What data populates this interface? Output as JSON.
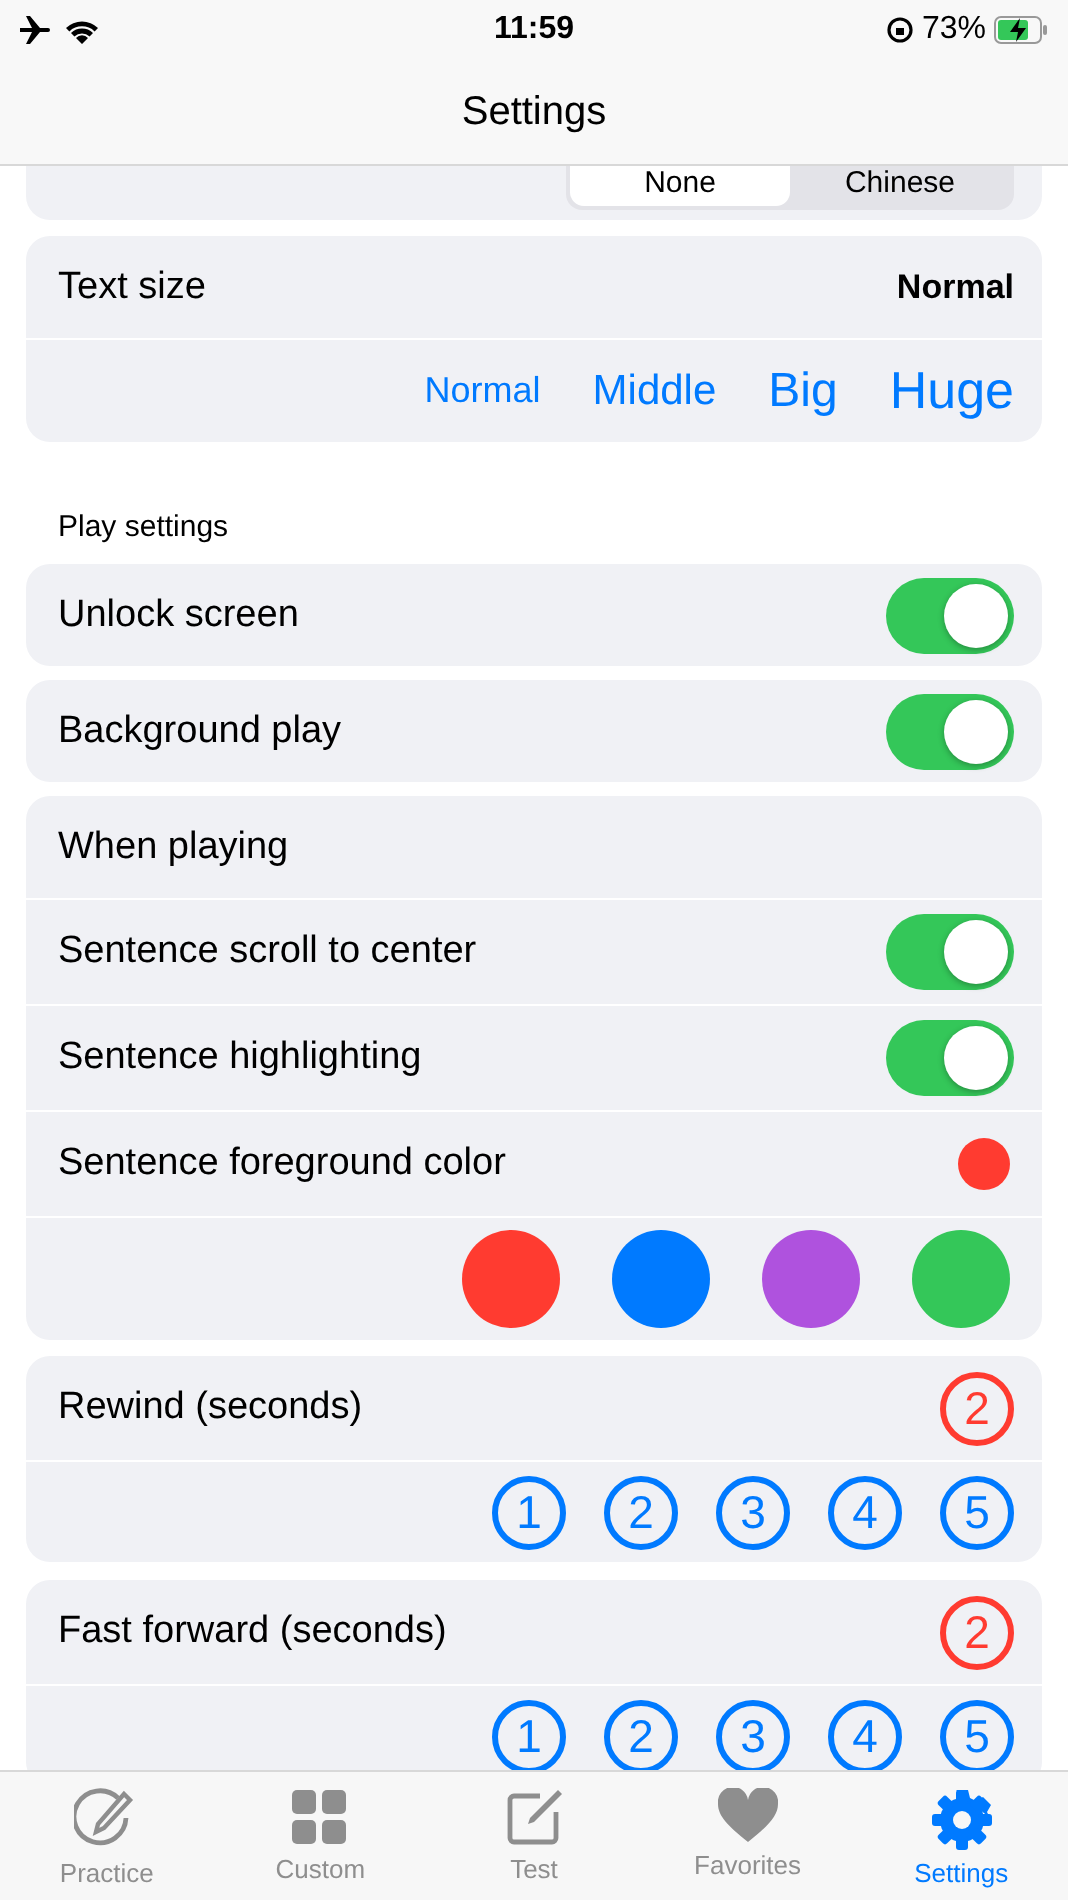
{
  "status_bar": {
    "time": "11:59",
    "battery": "73%"
  },
  "nav": {
    "title": "Settings"
  },
  "language_segments": [
    {
      "label": "None",
      "selected": true
    },
    {
      "label": "Chinese",
      "selected": false
    }
  ],
  "text_size": {
    "label": "Text size",
    "value": "Normal",
    "options": [
      "Normal",
      "Middle",
      "Big",
      "Huge"
    ]
  },
  "section_header": "Play settings",
  "toggles": [
    {
      "label": "Unlock screen",
      "on": true
    },
    {
      "label": "Background play",
      "on": true
    }
  ],
  "when_playing": {
    "label": "When playing",
    "toggles": [
      {
        "label": "Sentence scroll to center",
        "on": true
      },
      {
        "label": "Sentence highlighting",
        "on": true
      }
    ],
    "color_setting": {
      "label": "Sentence foreground color",
      "color": "#ff3b30",
      "options": [
        {
          "color": "#ff3b30"
        },
        {
          "color": "#007aff"
        },
        {
          "color": "#af52de"
        },
        {
          "color": "#34c759"
        }
      ]
    }
  },
  "steppers": [
    {
      "label": "Rewind (seconds)",
      "value": "2",
      "options": [
        "1",
        "2",
        "3",
        "4",
        "5"
      ]
    },
    {
      "label": "Fast forward (seconds)",
      "value": "2",
      "options": [
        "1",
        "2",
        "3",
        "4",
        "5"
      ]
    }
  ],
  "tab_bar": [
    {
      "label": "Practice",
      "selected": false
    },
    {
      "label": "Custom",
      "selected": false
    },
    {
      "label": "Test",
      "selected": false
    },
    {
      "label": "Favorites",
      "selected": false
    },
    {
      "label": "Settings",
      "selected": true
    }
  ]
}
